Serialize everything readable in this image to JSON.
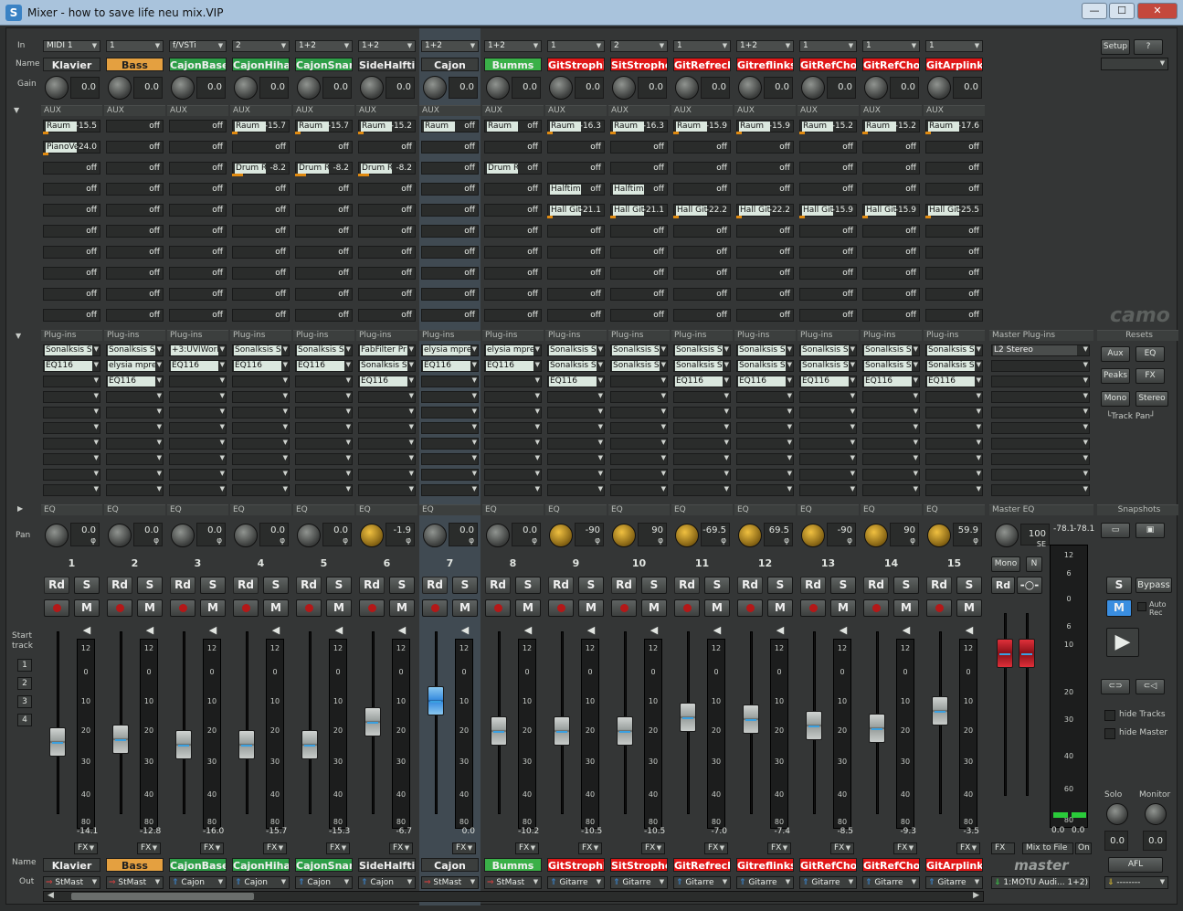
{
  "window": {
    "title": "Mixer - how to save life neu mix.VIP",
    "logo": "S"
  },
  "window_buttons": {
    "minimize": "—",
    "maximize": "☐",
    "close": "✕"
  },
  "row_labels": {
    "in": "In",
    "name": "Name",
    "gain": "Gain",
    "aux": "AUX",
    "plugins": "Plug-ins",
    "eq": "EQ",
    "pan": "Pan",
    "start_track": "Start track",
    "out": "Out"
  },
  "start_track_buttons": [
    "1",
    "2",
    "3",
    "4"
  ],
  "aux_header": "AUX",
  "plugins_header": "Plug-ins",
  "eq_header": "EQ",
  "channels": [
    {
      "num": "1",
      "in": "MIDI 1",
      "name": "Klavier",
      "name_bg": "#3b3e3d",
      "name_fg": "#f0f0f0",
      "gain": "0.0",
      "pan": "0.0",
      "pan_gold": false,
      "fader_pos": 0.7,
      "fader_val": "-14.1",
      "out": "StMast",
      "out_icon": "⇒",
      "aux": [
        [
          "Raum",
          "-15.5",
          true
        ],
        [
          "PianoVe",
          "-24.0",
          true
        ],
        [
          "",
          "off",
          false
        ],
        [
          "",
          "off",
          false
        ],
        [
          "",
          "off",
          false
        ],
        [
          "",
          "off",
          false
        ],
        [
          "",
          "off",
          false
        ],
        [
          "",
          "off",
          false
        ],
        [
          "",
          "off",
          false
        ],
        [
          "",
          "off",
          false
        ]
      ],
      "plugins": [
        "Sonalksis S",
        "EQ116",
        "",
        "",
        "",
        "",
        "",
        "",
        "",
        ""
      ]
    },
    {
      "num": "2",
      "in": "1",
      "name": "Bass",
      "name_bg": "#e4a040",
      "name_fg": "#222",
      "gain": "0.0",
      "pan": "0.0",
      "pan_gold": false,
      "fader_pos": 0.68,
      "fader_val": "-12.8",
      "out": "StMast",
      "out_icon": "⇒",
      "aux": [
        [
          "",
          "off",
          false
        ],
        [
          "",
          "off",
          false
        ],
        [
          "",
          "off",
          false
        ],
        [
          "",
          "off",
          false
        ],
        [
          "",
          "off",
          false
        ],
        [
          "",
          "off",
          false
        ],
        [
          "",
          "off",
          false
        ],
        [
          "",
          "off",
          false
        ],
        [
          "",
          "off",
          false
        ],
        [
          "",
          "off",
          false
        ]
      ],
      "plugins": [
        "Sonalksis S",
        "elysia mpre:",
        "EQ116",
        "",
        "",
        "",
        "",
        "",
        "",
        ""
      ]
    },
    {
      "num": "3",
      "in": "f/VSTi",
      "name": "CajonBase",
      "name_bg": "#2e9e48",
      "name_fg": "#f0f0f0",
      "gain": "0.0",
      "pan": "0.0",
      "pan_gold": false,
      "fader_pos": 0.72,
      "fader_val": "-16.0",
      "out": "Cajon",
      "out_icon": "⇑",
      "aux": [
        [
          "",
          "off",
          false
        ],
        [
          "",
          "off",
          false
        ],
        [
          "",
          "off",
          false
        ],
        [
          "",
          "off",
          false
        ],
        [
          "",
          "off",
          false
        ],
        [
          "",
          "off",
          false
        ],
        [
          "",
          "off",
          false
        ],
        [
          "",
          "off",
          false
        ],
        [
          "",
          "off",
          false
        ],
        [
          "",
          "off",
          false
        ]
      ],
      "plugins": [
        "+3:UVIWork",
        "EQ116",
        "",
        "",
        "",
        "",
        "",
        "",
        "",
        ""
      ]
    },
    {
      "num": "4",
      "in": "2",
      "name": "CajonHihat",
      "name_bg": "#2e9e48",
      "name_fg": "#f0f0f0",
      "gain": "0.0",
      "pan": "0.0",
      "pan_gold": false,
      "fader_pos": 0.72,
      "fader_val": "-15.7",
      "out": "Cajon",
      "out_icon": "⇑",
      "aux": [
        [
          "Raum",
          "-15.7",
          true
        ],
        [
          "",
          "off",
          false
        ],
        [
          "Drum Ra",
          "-8.2",
          true
        ],
        [
          "",
          "off",
          false
        ],
        [
          "",
          "off",
          false
        ],
        [
          "",
          "off",
          false
        ],
        [
          "",
          "off",
          false
        ],
        [
          "",
          "off",
          false
        ],
        [
          "",
          "off",
          false
        ],
        [
          "",
          "off",
          false
        ]
      ],
      "plugins": [
        "Sonalksis S",
        "EQ116",
        "",
        "",
        "",
        "",
        "",
        "",
        "",
        ""
      ]
    },
    {
      "num": "5",
      "in": "1+2",
      "name": "CajonSnare",
      "name_bg": "#2e9e48",
      "name_fg": "#f0f0f0",
      "gain": "0.0",
      "pan": "0.0",
      "pan_gold": false,
      "fader_pos": 0.72,
      "fader_val": "-15.3",
      "out": "Cajon",
      "out_icon": "⇑",
      "aux": [
        [
          "Raum",
          "-15.7",
          true
        ],
        [
          "",
          "off",
          false
        ],
        [
          "Drum Ra",
          "-8.2",
          true
        ],
        [
          "",
          "off",
          false
        ],
        [
          "",
          "off",
          false
        ],
        [
          "",
          "off",
          false
        ],
        [
          "",
          "off",
          false
        ],
        [
          "",
          "off",
          false
        ],
        [
          "",
          "off",
          false
        ],
        [
          "",
          "off",
          false
        ]
      ],
      "plugins": [
        "Sonalksis S",
        "EQ116",
        "",
        "",
        "",
        "",
        "",
        "",
        "",
        ""
      ]
    },
    {
      "num": "6",
      "in": "1+2",
      "name": "SideHalftime",
      "name_bg": "#3b3e3d",
      "name_fg": "#f0f0f0",
      "gain": "0.0",
      "pan": "-1.9",
      "pan_gold": true,
      "fader_pos": 0.55,
      "fader_val": "-6.7",
      "out": "Cajon",
      "out_icon": "⇑",
      "aux": [
        [
          "Raum",
          "-15.2",
          true
        ],
        [
          "",
          "off",
          false
        ],
        [
          "Drum Ra",
          "-8.2",
          true
        ],
        [
          "",
          "off",
          false
        ],
        [
          "",
          "off",
          false
        ],
        [
          "",
          "off",
          false
        ],
        [
          "",
          "off",
          false
        ],
        [
          "",
          "off",
          false
        ],
        [
          "",
          "off",
          false
        ],
        [
          "",
          "off",
          false
        ]
      ],
      "plugins": [
        "FabFilter Pr",
        "Sonalksis S",
        "EQ116",
        "",
        "",
        "",
        "",
        "",
        "",
        ""
      ]
    },
    {
      "num": "7",
      "in": "1+2",
      "name": "Cajon",
      "name_bg": "#3b3e3d",
      "name_fg": "#f0f0f0",
      "gain": "0.0",
      "pan": "0.0",
      "pan_gold": false,
      "fader_pos": 0.4,
      "fader_val": "0.0",
      "out": "StMast",
      "out_icon": "⇒",
      "aux": [
        [
          "Raum",
          "off",
          false
        ],
        [
          "",
          "off",
          false
        ],
        [
          "",
          "off",
          false
        ],
        [
          "",
          "off",
          false
        ],
        [
          "",
          "off",
          false
        ],
        [
          "",
          "off",
          false
        ],
        [
          "",
          "off",
          false
        ],
        [
          "",
          "off",
          false
        ],
        [
          "",
          "off",
          false
        ],
        [
          "",
          "off",
          false
        ]
      ],
      "plugins": [
        "elysia mpre:",
        "EQ116",
        "",
        "",
        "",
        "",
        "",
        "",
        "",
        ""
      ]
    },
    {
      "num": "8",
      "in": "1+2",
      "name": "Bumms",
      "name_bg": "#3ab048",
      "name_fg": "#f0f0f0",
      "gain": "0.0",
      "pan": "0.0",
      "pan_gold": false,
      "fader_pos": 0.62,
      "fader_val": "-10.2",
      "out": "StMast",
      "out_icon": "⇒",
      "aux": [
        [
          "Raum",
          "off",
          false
        ],
        [
          "",
          "off",
          false
        ],
        [
          "Drum Ra",
          "off",
          false
        ],
        [
          "",
          "off",
          false
        ],
        [
          "",
          "off",
          false
        ],
        [
          "",
          "off",
          false
        ],
        [
          "",
          "off",
          false
        ],
        [
          "",
          "off",
          false
        ],
        [
          "",
          "off",
          false
        ],
        [
          "",
          "off",
          false
        ]
      ],
      "plugins": [
        "elysia mpre:",
        "EQ116",
        "",
        "",
        "",
        "",
        "",
        "",
        "",
        ""
      ]
    },
    {
      "num": "9",
      "in": "1",
      "name": "GitStrophline",
      "name_bg": "#e01818",
      "name_fg": "#ffffff",
      "gain": "0.0",
      "pan": "-90",
      "pan_gold": true,
      "fader_pos": 0.62,
      "fader_val": "-10.5",
      "out": "Gitarre",
      "out_icon": "⇑",
      "aux": [
        [
          "Raum",
          "-16.3",
          true
        ],
        [
          "",
          "off",
          false
        ],
        [
          "",
          "off",
          false
        ],
        [
          "Halftime",
          "off",
          false
        ],
        [
          "Hall Git",
          "-21.1",
          true
        ],
        [
          "",
          "off",
          false
        ],
        [
          "",
          "off",
          false
        ],
        [
          "",
          "off",
          false
        ],
        [
          "",
          "off",
          false
        ],
        [
          "",
          "off",
          false
        ]
      ],
      "plugins": [
        "Sonalksis S",
        "Sonalksis S",
        "EQ116",
        "",
        "",
        "",
        "",
        "",
        "",
        ""
      ]
    },
    {
      "num": "10",
      "in": "2",
      "name": "SitStrophe",
      "name_bg": "#e01818",
      "name_fg": "#ffffff",
      "gain": "0.0",
      "pan": "90",
      "pan_gold": true,
      "fader_pos": 0.62,
      "fader_val": "-10.5",
      "out": "Gitarre",
      "out_icon": "⇑",
      "aux": [
        [
          "Raum",
          "-16.3",
          true
        ],
        [
          "",
          "off",
          false
        ],
        [
          "",
          "off",
          false
        ],
        [
          "Halftime",
          "off",
          false
        ],
        [
          "Hall Git",
          "-21.1",
          true
        ],
        [
          "",
          "off",
          false
        ],
        [
          "",
          "off",
          false
        ],
        [
          "",
          "off",
          false
        ],
        [
          "",
          "off",
          false
        ],
        [
          "",
          "off",
          false
        ]
      ],
      "plugins": [
        "Sonalksis S",
        "Sonalksis S",
        "",
        "",
        "",
        "",
        "",
        "",
        "",
        ""
      ]
    },
    {
      "num": "11",
      "in": "1",
      "name": "GitRefrecht",
      "name_bg": "#e01818",
      "name_fg": "#ffffff",
      "gain": "0.0",
      "pan": "-69.5",
      "pan_gold": true,
      "fader_pos": 0.52,
      "fader_val": "-7.0",
      "out": "Gitarre",
      "out_icon": "⇑",
      "aux": [
        [
          "Raum",
          "-15.9",
          true
        ],
        [
          "",
          "off",
          false
        ],
        [
          "",
          "off",
          false
        ],
        [
          "",
          "off",
          false
        ],
        [
          "Hall Git",
          "-22.2",
          true
        ],
        [
          "",
          "off",
          false
        ],
        [
          "",
          "off",
          false
        ],
        [
          "",
          "off",
          false
        ],
        [
          "",
          "off",
          false
        ],
        [
          "",
          "off",
          false
        ]
      ],
      "plugins": [
        "Sonalksis S",
        "Sonalksis S",
        "EQ116",
        "",
        "",
        "",
        "",
        "",
        "",
        ""
      ]
    },
    {
      "num": "12",
      "in": "1+2",
      "name": "Gitreflinks",
      "name_bg": "#e01818",
      "name_fg": "#ffffff",
      "gain": "0.0",
      "pan": "69.5",
      "pan_gold": true,
      "fader_pos": 0.53,
      "fader_val": "-7.4",
      "out": "Gitarre",
      "out_icon": "⇑",
      "aux": [
        [
          "Raum",
          "-15.9",
          true
        ],
        [
          "",
          "off",
          false
        ],
        [
          "",
          "off",
          false
        ],
        [
          "",
          "off",
          false
        ],
        [
          "Hall Git",
          "-22.2",
          true
        ],
        [
          "",
          "off",
          false
        ],
        [
          "",
          "off",
          false
        ],
        [
          "",
          "off",
          false
        ],
        [
          "",
          "off",
          false
        ],
        [
          "",
          "off",
          false
        ]
      ],
      "plugins": [
        "Sonalksis S",
        "Sonalksis S",
        "EQ116",
        "",
        "",
        "",
        "",
        "",
        "",
        ""
      ]
    },
    {
      "num": "13",
      "in": "1",
      "name": "GitRefChords",
      "name_bg": "#e01818",
      "name_fg": "#ffffff",
      "gain": "0.0",
      "pan": "-90",
      "pan_gold": true,
      "fader_pos": 0.58,
      "fader_val": "-8.5",
      "out": "Gitarre",
      "out_icon": "⇑",
      "aux": [
        [
          "Raum",
          "-15.2",
          true
        ],
        [
          "",
          "off",
          false
        ],
        [
          "",
          "off",
          false
        ],
        [
          "",
          "off",
          false
        ],
        [
          "Hall Git",
          "-15.9",
          true
        ],
        [
          "",
          "off",
          false
        ],
        [
          "",
          "off",
          false
        ],
        [
          "",
          "off",
          false
        ],
        [
          "",
          "off",
          false
        ],
        [
          "",
          "off",
          false
        ]
      ],
      "plugins": [
        "Sonalksis S",
        "Sonalksis S",
        "EQ116",
        "",
        "",
        "",
        "",
        "",
        "",
        ""
      ]
    },
    {
      "num": "14",
      "in": "1",
      "name": "GitRefChords",
      "name_bg": "#e01818",
      "name_fg": "#ffffff",
      "gain": "0.0",
      "pan": "90",
      "pan_gold": true,
      "fader_pos": 0.6,
      "fader_val": "-9.3",
      "out": "Gitarre",
      "out_icon": "⇑",
      "aux": [
        [
          "Raum",
          "-15.2",
          true
        ],
        [
          "",
          "off",
          false
        ],
        [
          "",
          "off",
          false
        ],
        [
          "",
          "off",
          false
        ],
        [
          "Hall Git",
          "-15.9",
          true
        ],
        [
          "",
          "off",
          false
        ],
        [
          "",
          "off",
          false
        ],
        [
          "",
          "off",
          false
        ],
        [
          "",
          "off",
          false
        ],
        [
          "",
          "off",
          false
        ]
      ],
      "plugins": [
        "Sonalksis S",
        "Sonalksis S",
        "EQ116",
        "",
        "",
        "",
        "",
        "",
        "",
        ""
      ]
    },
    {
      "num": "15",
      "in": "1",
      "name": "GitArplinks",
      "name_bg": "#e01818",
      "name_fg": "#ffffff",
      "gain": "0.0",
      "pan": "59.9",
      "pan_gold": true,
      "fader_pos": 0.47,
      "fader_val": "-3.5",
      "out": "Gitarre",
      "out_icon": "⇑",
      "aux": [
        [
          "Raum",
          "-17.6",
          true
        ],
        [
          "",
          "off",
          false
        ],
        [
          "",
          "off",
          false
        ],
        [
          "",
          "off",
          false
        ],
        [
          "Hall Git",
          "-25.5",
          true
        ],
        [
          "",
          "off",
          false
        ],
        [
          "",
          "off",
          false
        ],
        [
          "",
          "off",
          false
        ],
        [
          "",
          "off",
          false
        ],
        [
          "",
          "off",
          false
        ]
      ],
      "plugins": [
        "Sonalksis S",
        "Sonalksis S",
        "EQ116",
        "",
        "",
        "",
        "",
        "",
        "",
        ""
      ]
    }
  ],
  "strip_buttons": {
    "rd": "Rd",
    "s": "S",
    "m": "M",
    "fx": "FX"
  },
  "meter_scale": [
    "12",
    "0",
    "10",
    "20",
    "30",
    "40",
    "80"
  ],
  "master": {
    "plugins_header": "Master Plug-ins",
    "plugins": [
      "L2 Stereo",
      "",
      "",
      "",
      "",
      "",
      "",
      "",
      "",
      ""
    ],
    "eq_header": "Master EQ",
    "pan": "100",
    "pan_mode": "SE",
    "peak_left": "-78.1",
    "peak_right": "-78.1",
    "mono": "Mono",
    "n": "N",
    "rd": "Rd",
    "meter_scale": [
      "12",
      "6",
      "0",
      "6",
      "10",
      "20",
      "30",
      "40",
      "60",
      "80"
    ],
    "val_left": "0.0",
    "val_right": "0.0",
    "fx": "FX",
    "mix_to_file": "Mix to File",
    "on": "On",
    "name": "master",
    "out": "1:MOTU Audi... 1+2)",
    "out_icon": "⇓"
  },
  "right_panel": {
    "setup": "Setup",
    "help": "?",
    "resets": "Resets",
    "aux": "Aux",
    "eq": "EQ",
    "peaks": "Peaks",
    "fx": "FX",
    "mono": "Mono",
    "stereo": "Stereo",
    "track_pan": "└Track Pan┘",
    "snapshots": "Snapshots",
    "s": "S",
    "bypass": "Bypass",
    "m": "M",
    "auto_rec": "Auto Rec",
    "hide_tracks": "hide Tracks",
    "hide_master": "hide Master",
    "solo": "Solo",
    "monitor": "Monitor",
    "solo_val": "0.0",
    "monitor_val": "0.0",
    "afl": "AFL",
    "out": "--------",
    "brand": "camo"
  },
  "colors": {
    "accent_blue": "#3a8ee0",
    "record_red": "#b41818",
    "aux_orange": "#e08a10",
    "gold_knob": "#f0c040"
  }
}
